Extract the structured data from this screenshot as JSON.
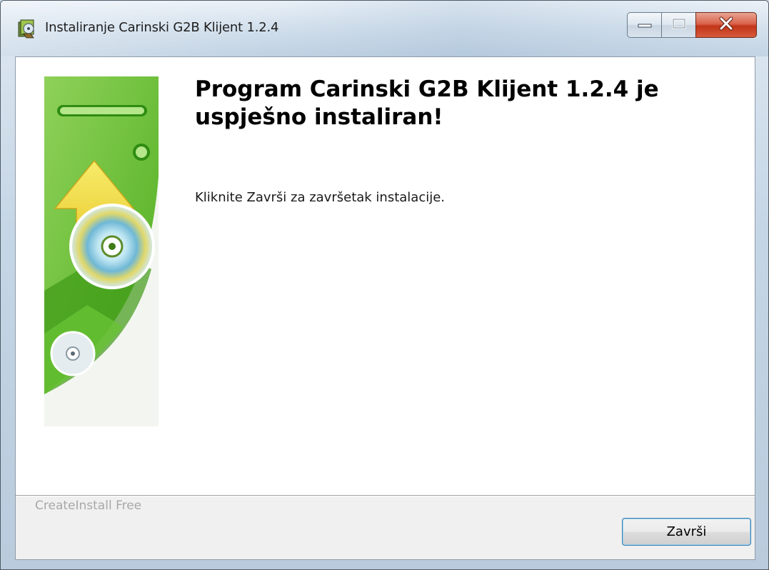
{
  "window": {
    "title": "Instaliranje Carinski G2B Klijent 1.2.4",
    "app_icon": "installer-icon"
  },
  "caption_buttons": {
    "minimize_icon": "minimize-icon",
    "maximize_icon": "maximize-icon",
    "close_icon": "close-icon",
    "close_color": "#c7361a"
  },
  "content": {
    "heading": "Program Carinski G2B Klijent 1.2.4 je uspješno instaliran!",
    "body": "Kliknite Završi za završetak instalacije."
  },
  "footer": {
    "brand": "CreateInstall Free",
    "finish_label": "Završi"
  },
  "colors": {
    "accent_green": "#5fbf2a",
    "light_green": "#9fd96a",
    "arrow_yellow": "#f2e14c"
  }
}
